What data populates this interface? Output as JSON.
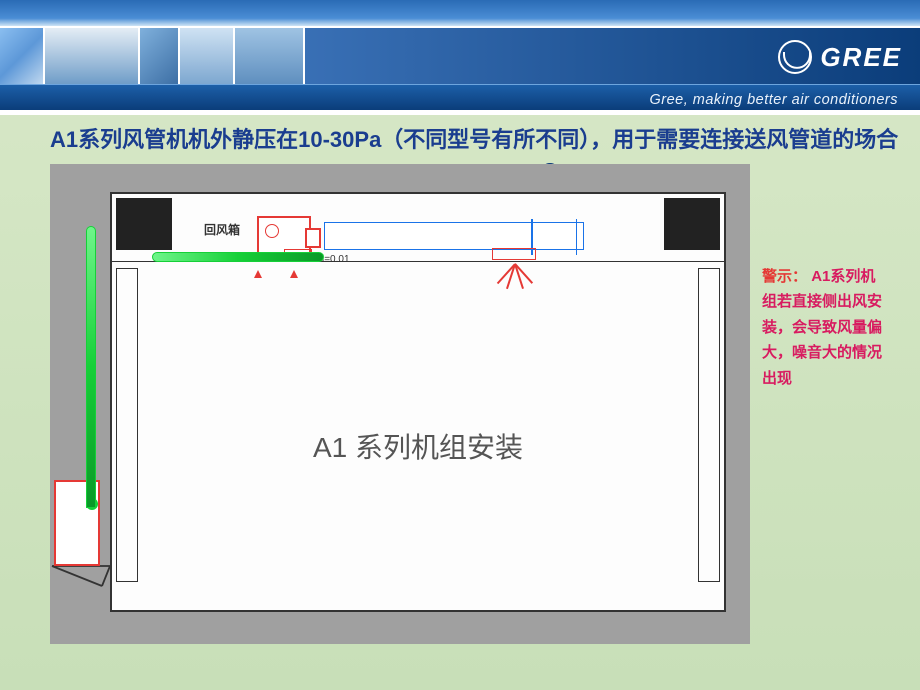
{
  "brand": {
    "name": "GREE",
    "tagline": "Gree, making better air conditioners",
    "arrow_icon": "←"
  },
  "heading": "A1系列风管机机外静压在10-30Pa（不同型号有所不同），用于需要连接送风管道的场合",
  "diagram": {
    "room_title": "A1 系列机组安装",
    "return_box_label": "回风箱",
    "drain_slope_label": "i=0.01"
  },
  "warning": {
    "title": "警示：",
    "body": "A1系列机组若直接侧出风安装，会导致风量偏大，噪音大的情况出现"
  }
}
